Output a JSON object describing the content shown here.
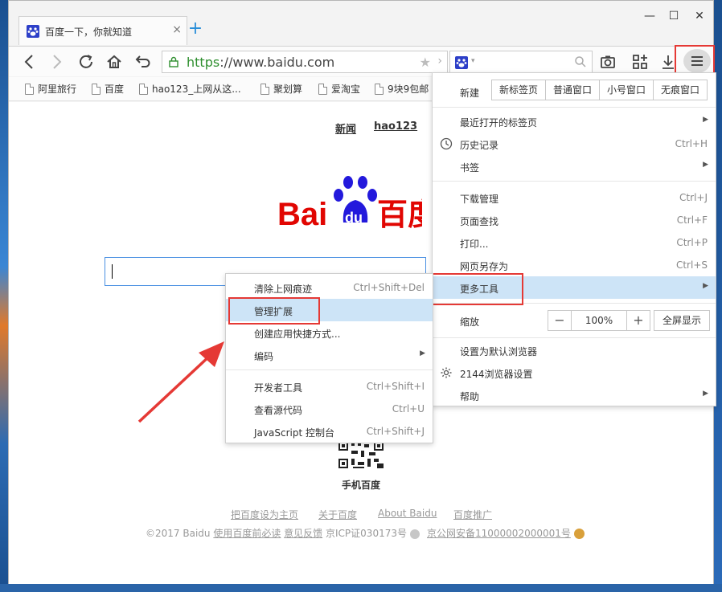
{
  "tab": {
    "title": "百度一下，你就知道",
    "close": "×",
    "new_tab": "+"
  },
  "window_controls": {
    "minimize": "—",
    "maximize": "☐",
    "close": "✕"
  },
  "address_bar": {
    "https": "https",
    "rest": "://www.baidu.com"
  },
  "search_engine": {
    "dropdown": "▾"
  },
  "bookmarks": [
    "阿里旅行",
    "百度",
    "hao123_上网从这...",
    "聚划算",
    "爱淘宝",
    "9块9包邮"
  ],
  "page": {
    "top_links": [
      "新闻",
      "hao123"
    ],
    "logo_text_left": "Bai",
    "logo_text_paw": "du",
    "logo_text_right": "百度",
    "qr_label": "手机百度",
    "footer_links": [
      "把百度设为主页",
      "关于百度",
      "About  Baidu",
      "百度推广"
    ],
    "copyright_prefix": "©2017 Baidu",
    "footer_notice": "使用百度前必读",
    "footer_feedback": "意见反馈",
    "footer_icp": "京ICP证030173号",
    "footer_police": "京公网安备11000002000001号"
  },
  "main_menu": {
    "new_label": "新建",
    "new_buttons": [
      "新标签页",
      "普通窗口",
      "小号窗口",
      "无痕窗口"
    ],
    "items": [
      {
        "label": "最近打开的标签页",
        "shortcut": "",
        "arrow": "▶"
      },
      {
        "label": "历史记录",
        "shortcut": "Ctrl+H",
        "arrow": ""
      },
      {
        "label": "书签",
        "shortcut": "",
        "arrow": "▶"
      },
      {
        "label": "下载管理",
        "shortcut": "Ctrl+J",
        "arrow": ""
      },
      {
        "label": "页面查找",
        "shortcut": "Ctrl+F",
        "arrow": ""
      },
      {
        "label": "打印...",
        "shortcut": "Ctrl+P",
        "arrow": ""
      },
      {
        "label": "网页另存为",
        "shortcut": "Ctrl+S",
        "arrow": ""
      },
      {
        "label": "更多工具",
        "shortcut": "",
        "arrow": "▶"
      },
      {
        "label": "设置为默认浏览器",
        "shortcut": "",
        "arrow": ""
      },
      {
        "label": "2144浏览器设置",
        "shortcut": "",
        "arrow": ""
      },
      {
        "label": "帮助",
        "shortcut": "",
        "arrow": "▶"
      }
    ],
    "zoom_label": "缩放",
    "zoom_minus": "−",
    "zoom_value": "100%",
    "zoom_plus": "+",
    "fullscreen": "全屏显示"
  },
  "submenu": {
    "items": [
      {
        "label": "清除上网痕迹",
        "shortcut": "Ctrl+Shift+Del",
        "arrow": ""
      },
      {
        "label": "管理扩展",
        "shortcut": "",
        "arrow": ""
      },
      {
        "label": "创建应用快捷方式...",
        "shortcut": "",
        "arrow": ""
      },
      {
        "label": "编码",
        "shortcut": "",
        "arrow": "▶"
      },
      {
        "label": "开发者工具",
        "shortcut": "Ctrl+Shift+I",
        "arrow": ""
      },
      {
        "label": "查看源代码",
        "shortcut": "Ctrl+U",
        "arrow": ""
      },
      {
        "label": "JavaScript 控制台",
        "shortcut": "Ctrl+Shift+J",
        "arrow": ""
      }
    ]
  },
  "colors": {
    "accent_blue": "#2a8ed8",
    "baidu_red": "#e10602",
    "baidu_blue": "#2319dc",
    "annotation_red": "#e53935",
    "menu_highlight": "#cde4f7"
  }
}
